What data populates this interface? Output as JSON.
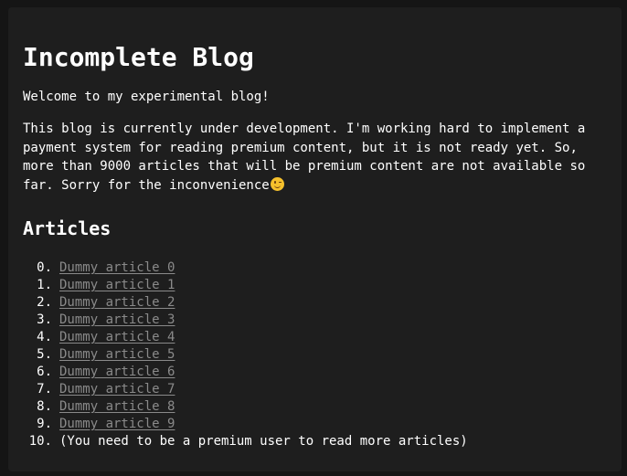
{
  "header": {
    "title": "Incomplete Blog"
  },
  "intro": {
    "welcome": "Welcome to my experimental blog!",
    "description": "This blog is currently under development. I'm working hard to implement a payment system for reading premium content, but it is not ready yet. So, more than 9000 articles that will be premium content are not available so far. Sorry for the inconvenience",
    "emoji_icon": "winking-face-icon"
  },
  "articles": {
    "heading": "Articles",
    "items": [
      {
        "number": "0.",
        "label": "Dummy article 0"
      },
      {
        "number": "1.",
        "label": "Dummy article 1"
      },
      {
        "number": "2.",
        "label": "Dummy article 2"
      },
      {
        "number": "3.",
        "label": "Dummy article 3"
      },
      {
        "number": "4.",
        "label": "Dummy article 4"
      },
      {
        "number": "5.",
        "label": "Dummy article 5"
      },
      {
        "number": "6.",
        "label": "Dummy article 6"
      },
      {
        "number": "7.",
        "label": "Dummy article 7"
      },
      {
        "number": "8.",
        "label": "Dummy article 8"
      },
      {
        "number": "9.",
        "label": "Dummy article 9"
      }
    ],
    "premium_note": {
      "number": "10.",
      "text": "(You need to be a premium user to read more articles)"
    }
  },
  "colors": {
    "page_background": "#151515",
    "card_background": "#1e1e1e",
    "text": "#ffffff",
    "link": "#8a8a8a"
  }
}
